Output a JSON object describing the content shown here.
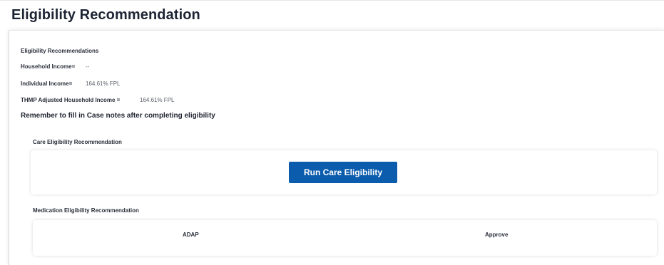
{
  "page": {
    "title": "Eligibility Recommendation"
  },
  "summary": {
    "heading": "Eligibility Recommendations",
    "household_income_label": "Household Income=",
    "household_income_value": "--",
    "individual_income_label": "Individual Income=",
    "individual_income_value": "164.61% FPL",
    "thmp_label": "THMP Adjusted Household Income =",
    "thmp_value": "164.61% FPL",
    "notice": "Remember to fill in Case notes after completing eligibility"
  },
  "care": {
    "heading": "Care Eligibility Recommendation",
    "button_label": "Run Care Eligibility"
  },
  "medication": {
    "heading": "Medication Eligibility Recommendation",
    "rows": [
      {
        "program": "ADAP",
        "status": "Approve"
      }
    ]
  },
  "colors": {
    "accent": "#0b5cad",
    "text": "#1f2430"
  }
}
